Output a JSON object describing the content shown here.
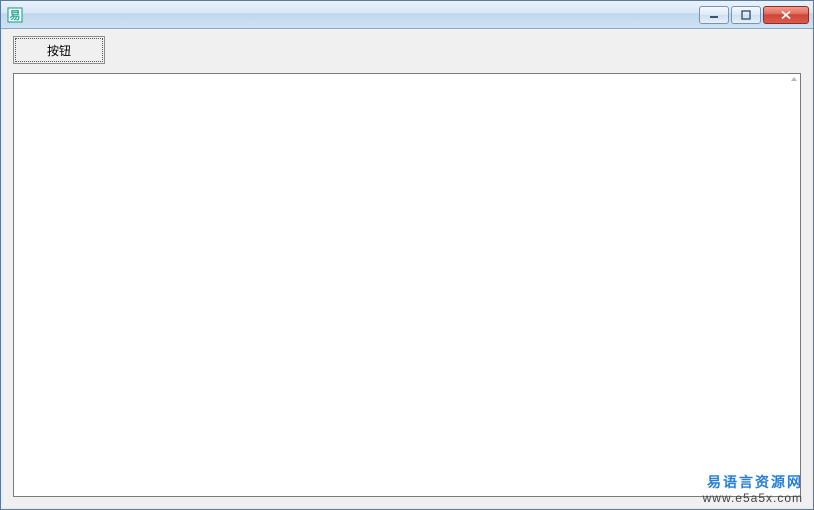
{
  "window": {
    "title": "",
    "icon": "app-icon"
  },
  "controls": {
    "minimize": "minimize",
    "maximize": "maximize",
    "close": "close"
  },
  "toolbar": {
    "button_label": "按钮"
  },
  "editor": {
    "content": ""
  },
  "watermark": {
    "line1": "易语言资源网",
    "line2": "www.e5a5x.com"
  }
}
